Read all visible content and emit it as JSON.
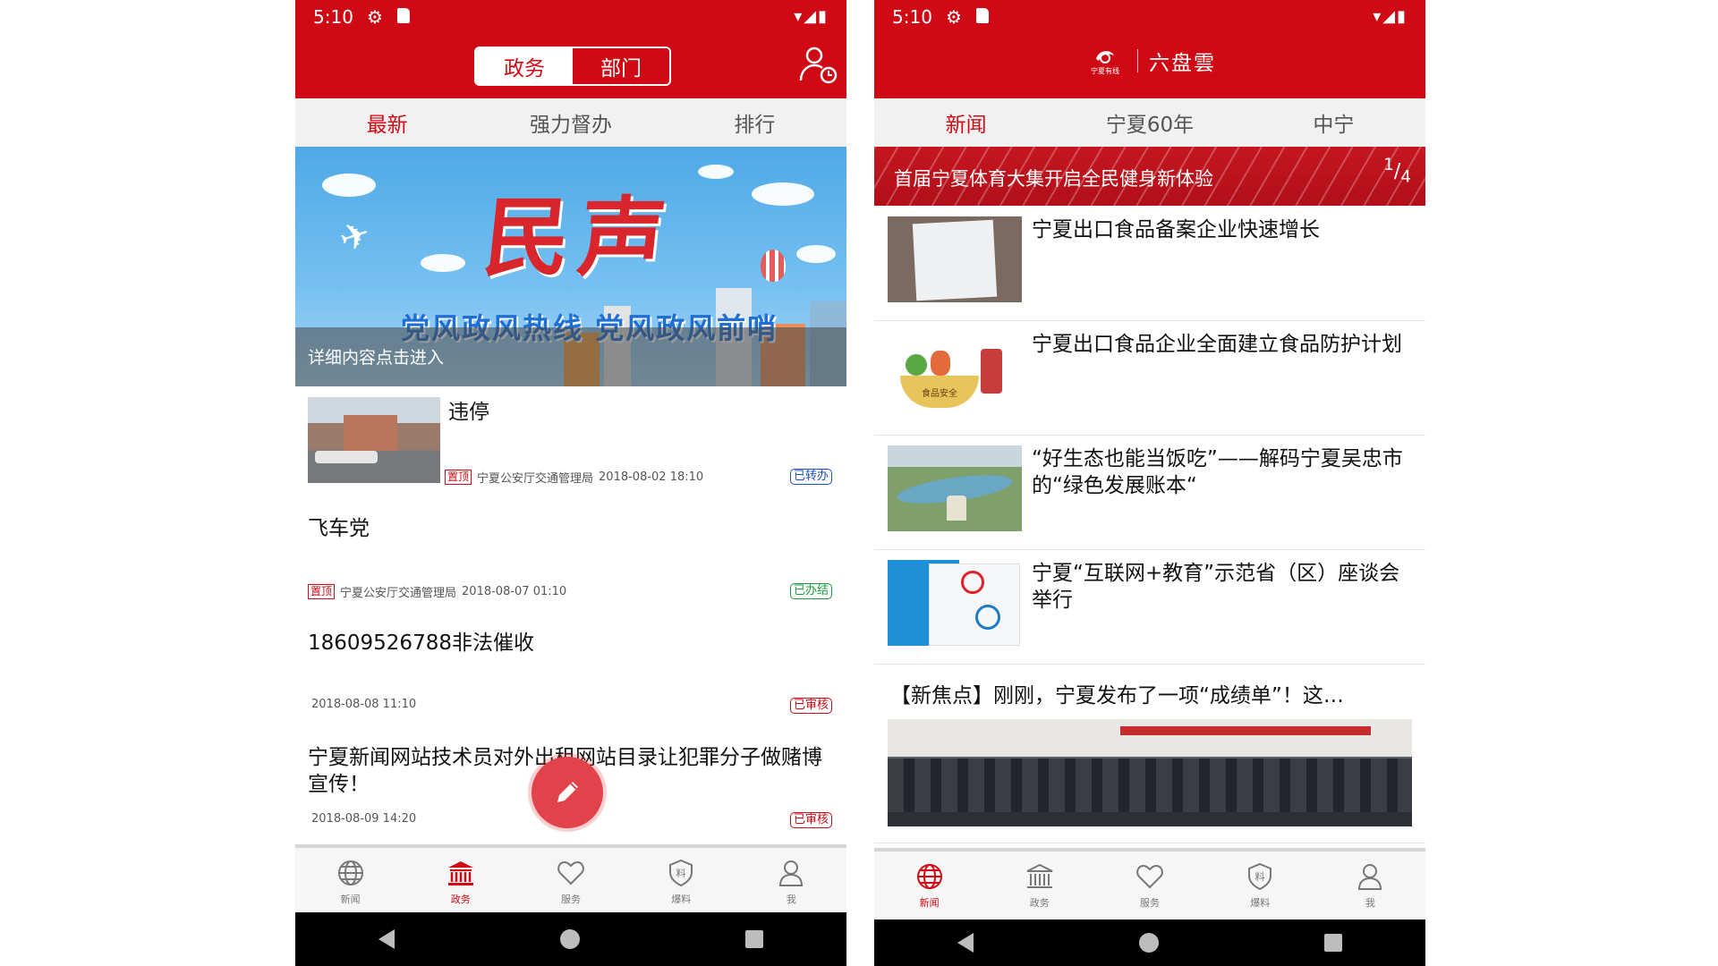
{
  "left": {
    "status": {
      "time": "5:10"
    },
    "header": {
      "seg_active": "政务",
      "seg_inactive": "部门"
    },
    "tabs": [
      "最新",
      "强力督办",
      "排行"
    ],
    "banner": {
      "big_text": "民声",
      "sub_text": "党风政风热线 党风政风前哨",
      "caption": "详细内容点击进入"
    },
    "items": [
      {
        "title": "违停",
        "pinned": "置顶",
        "source": "宁夏公安厅交通管理局",
        "time": "2018-08-02 18:10",
        "status": "已转办"
      },
      {
        "title": "飞车党",
        "pinned": "置顶",
        "source": "宁夏公安厅交通管理局",
        "time": "2018-08-07 01:10",
        "status": "已办结"
      },
      {
        "title": "18609526788非法催收",
        "time": "2018-08-08 11:10",
        "status": "已审核"
      },
      {
        "title": "宁夏新闻网站技术员对外出租网站目录让犯罪分子做赌博宣传！",
        "time": "2018-08-09 14:20",
        "status": "已审核"
      }
    ],
    "bottom_nav": [
      "新闻",
      "政务",
      "服务",
      "爆料",
      "我"
    ]
  },
  "right": {
    "status": {
      "time": "5:10"
    },
    "header": {
      "logo_text": "宁夏有线",
      "brand": "六盘雲"
    },
    "tabs": [
      "新闻",
      "宁夏60年",
      "中宁"
    ],
    "carousel": {
      "title": "首届宁夏体育大集开启全民健身新体验",
      "page_current": "1",
      "page_total": "4"
    },
    "items": [
      {
        "title": "宁夏出口食品备案企业快速增长"
      },
      {
        "title": "宁夏出口食品企业全面建立食品防护计划",
        "thumb_label": "食品安全"
      },
      {
        "title": "“好生态也能当饭吃”——解码宁夏吴忠市的“绿色发展账本“"
      },
      {
        "title": "宁夏“互联网+教育”示范省（区）座谈会举行"
      }
    ],
    "feature": {
      "title": "【新焦点】刚刚，宁夏发布了一项“成绩单”！这…"
    },
    "bottom_nav": [
      "新闻",
      "政务",
      "服务",
      "爆料",
      "我"
    ]
  },
  "colors": {
    "brand_red": "#cf0a14",
    "status_blue": "#1c4fbf",
    "status_green": "#1a9b3c"
  }
}
